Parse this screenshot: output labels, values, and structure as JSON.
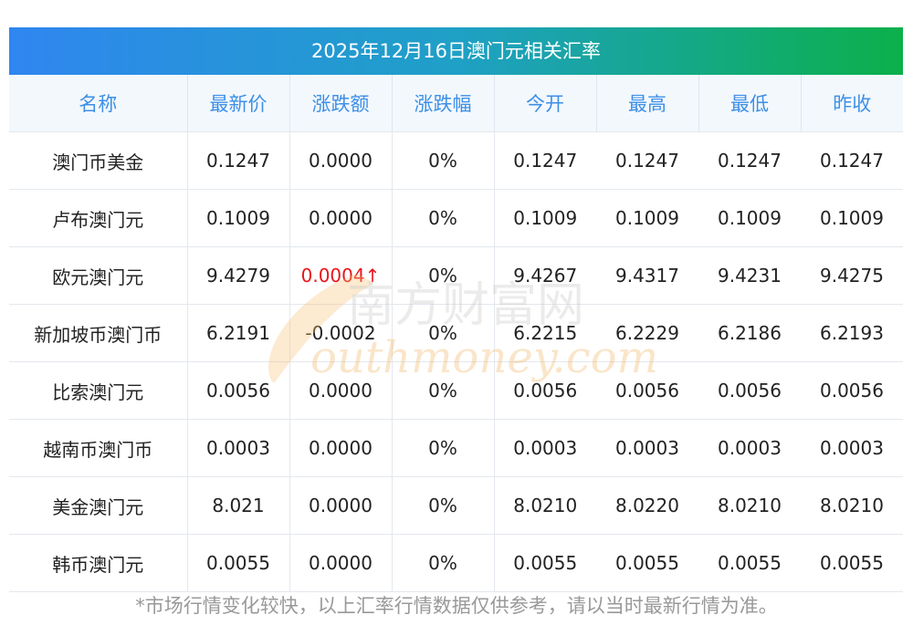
{
  "title": "2025年12月16日澳门元相关汇率",
  "headers": [
    "名称",
    "最新价",
    "涨跌额",
    "涨跌幅",
    "今开",
    "最高",
    "最低",
    "昨收"
  ],
  "rows": [
    {
      "name": "澳门币美金",
      "latest": "0.1247",
      "change": "0.0000",
      "change_dir": "",
      "pct": "0%",
      "open": "0.1247",
      "high": "0.1247",
      "low": "0.1247",
      "prev": "0.1247"
    },
    {
      "name": "卢布澳门元",
      "latest": "0.1009",
      "change": "0.0000",
      "change_dir": "",
      "pct": "0%",
      "open": "0.1009",
      "high": "0.1009",
      "low": "0.1009",
      "prev": "0.1009"
    },
    {
      "name": "欧元澳门元",
      "latest": "9.4279",
      "change": "0.0004↑",
      "change_dir": "up",
      "pct": "0%",
      "open": "9.4267",
      "high": "9.4317",
      "low": "9.4231",
      "prev": "9.4275"
    },
    {
      "name": "新加坡币澳门币",
      "latest": "6.2191",
      "change": "-0.0002",
      "change_dir": "",
      "pct": "0%",
      "open": "6.2215",
      "high": "6.2229",
      "low": "6.2186",
      "prev": "6.2193"
    },
    {
      "name": "比索澳门元",
      "latest": "0.0056",
      "change": "0.0000",
      "change_dir": "",
      "pct": "0%",
      "open": "0.0056",
      "high": "0.0056",
      "low": "0.0056",
      "prev": "0.0056"
    },
    {
      "name": "越南币澳门币",
      "latest": "0.0003",
      "change": "0.0000",
      "change_dir": "",
      "pct": "0%",
      "open": "0.0003",
      "high": "0.0003",
      "low": "0.0003",
      "prev": "0.0003"
    },
    {
      "name": "美金澳门元",
      "latest": "8.021",
      "change": "0.0000",
      "change_dir": "",
      "pct": "0%",
      "open": "8.0210",
      "high": "8.0220",
      "low": "8.0210",
      "prev": "8.0210"
    },
    {
      "name": "韩币澳门元",
      "latest": "0.0055",
      "change": "0.0000",
      "change_dir": "",
      "pct": "0%",
      "open": "0.0055",
      "high": "0.0055",
      "low": "0.0055",
      "prev": "0.0055"
    }
  ],
  "footer_note": "*市场行情变化较快，以上汇率行情数据仅供参考，请以当时最新行情为准。",
  "watermark": {
    "cn": "南方财富网",
    "en": "outhmoney.com"
  },
  "colors": {
    "header_text": "#3d8fe6",
    "up": "#e8151b",
    "title_left": "#2f86f0",
    "title_right": "#0bb04a"
  }
}
